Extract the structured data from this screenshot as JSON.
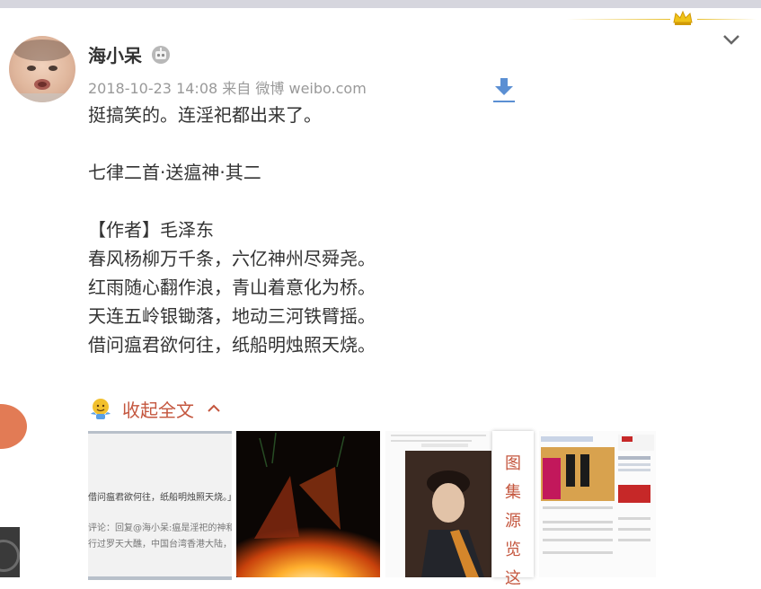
{
  "post": {
    "author": "海小呆",
    "timestamp": "2018-10-23 14:08",
    "source_prefix": "来自",
    "source": "微博 weibo.com",
    "content": "挺搞笑的。连淫祀都出来了。\n\n七律二首·送瘟神·其二\n\n【作者】毛泽东\n春风杨柳万千条，六亿神州尽舜尧。\n红雨随心翻作浪，青山着意化为桥。\n天连五岭银锄落，地动三河铁臂摇。\n借问瘟君欲何往，纸船明烛照天烧。",
    "collapse_label": "收起全文"
  },
  "image_source_panel": {
    "chars": [
      "图",
      "集",
      "源",
      "览",
      "这"
    ]
  },
  "thumbs": {
    "thumb1_line1": "借问瘟君欲何往，纸船明烛照天烧。」",
    "thumb1_line2": "评论：回复@海小呆:瘟是淫祀的神和迷",
    "thumb1_line3": "行过罗天大醮，中国台湾香港大陆，美"
  },
  "icons": {
    "vip": "robot-badge-icon",
    "expand": "chevron-down-icon",
    "download": "download-icon",
    "collapse_emoji": "emoji-icon",
    "collapse_arrow": "chevron-up-icon",
    "crown": "crown-icon"
  },
  "colors": {
    "accent": "#c4563e",
    "meta": "#999999",
    "text": "#333333",
    "download": "#5b8fd3",
    "gold": "#e8be28"
  }
}
